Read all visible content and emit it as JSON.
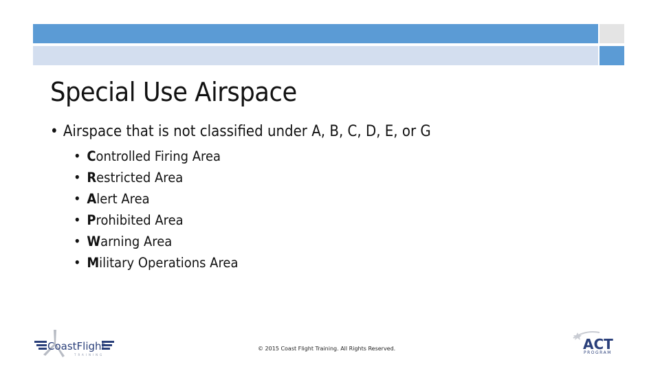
{
  "slide": {
    "title": "Special Use Airspace",
    "main_bullet": "Airspace that is not classified under A, B, C, D, E, or G",
    "bullet_symbol": "•",
    "sub_bullets": [
      {
        "initial": "C",
        "rest": "ontrolled Firing Area"
      },
      {
        "initial": "R",
        "rest": "estricted Area"
      },
      {
        "initial": "A",
        "rest": "lert Area"
      },
      {
        "initial": "P",
        "rest": "rohibited Area"
      },
      {
        "initial": "W",
        "rest": "arning Area"
      },
      {
        "initial": "M",
        "rest": "ilitary Operations Area"
      }
    ],
    "footer": "© 2015 Coast Flight Training. All Rights Reserved."
  },
  "logos": {
    "left": {
      "name": "CoastFlight",
      "subtitle": "TRAINING"
    },
    "right": {
      "name": "ACT",
      "subtitle": "PROGRAM"
    }
  },
  "colors": {
    "accent_blue": "#5b9bd5",
    "light_blue": "#d3deef",
    "light_gray": "#e4e4e4",
    "logo_navy": "#2a3f7a"
  }
}
